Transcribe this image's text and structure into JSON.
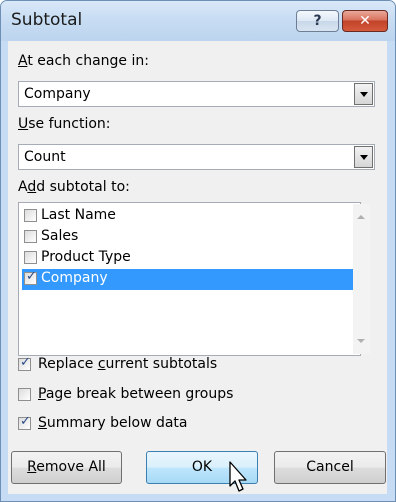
{
  "window": {
    "title": "Subtotal",
    "help_glyph": "?",
    "close_glyph": "✕"
  },
  "change_field": {
    "label_mnemonic": "A",
    "label_rest": "t each change in:",
    "value": "Company"
  },
  "function_field": {
    "label_mnemonic": "U",
    "label_rest": "se function:",
    "value": "Count"
  },
  "subtotal_list": {
    "label_pre": "A",
    "label_mnemonic": "d",
    "label_rest": "d subtotal to:",
    "items": [
      {
        "label": "Last Name",
        "checked": false,
        "selected": false
      },
      {
        "label": "Sales",
        "checked": false,
        "selected": false
      },
      {
        "label": "Product Type",
        "checked": false,
        "selected": false
      },
      {
        "label": "Company",
        "checked": true,
        "selected": true
      }
    ]
  },
  "options": {
    "replace": {
      "pre": "Replace ",
      "mnemonic": "c",
      "rest": "urrent subtotals",
      "checked": true
    },
    "page_break": {
      "pre": "",
      "mnemonic": "P",
      "rest": "age break between groups",
      "checked": false
    },
    "summary": {
      "pre": "",
      "mnemonic": "S",
      "rest": "ummary below data",
      "checked": true
    }
  },
  "buttons": {
    "remove_all": {
      "mnemonic": "R",
      "rest": "emove All"
    },
    "ok": "OK",
    "cancel": "Cancel"
  },
  "check_glyph": "✓"
}
